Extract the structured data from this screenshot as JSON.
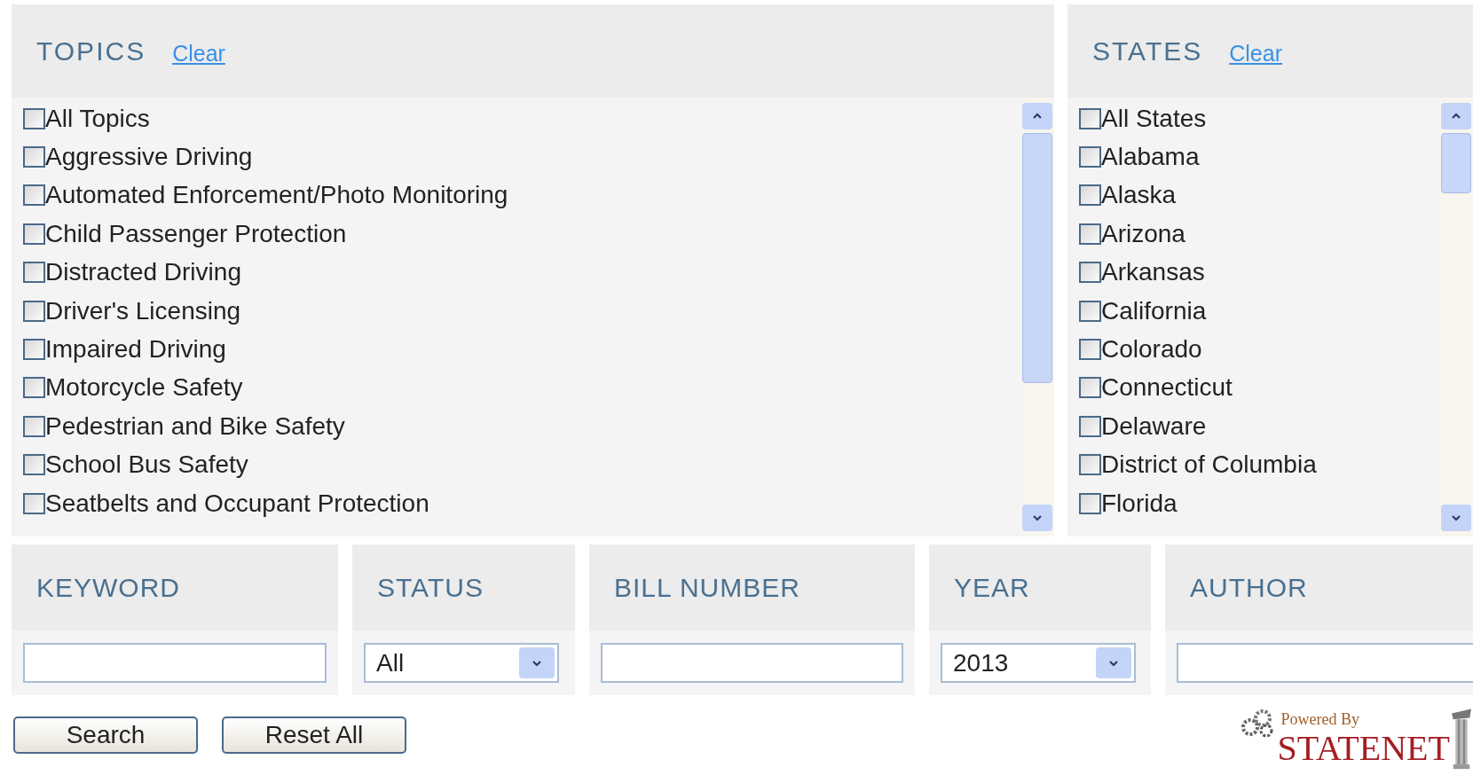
{
  "topics": {
    "title": "TOPICS",
    "clear": "Clear",
    "items": [
      {
        "label": "All Topics",
        "checked": false
      },
      {
        "label": "Aggressive Driving",
        "checked": false
      },
      {
        "label": "Automated Enforcement/Photo Monitoring",
        "checked": false
      },
      {
        "label": "Child Passenger Protection",
        "checked": false
      },
      {
        "label": "Distracted Driving",
        "checked": false
      },
      {
        "label": "Driver's Licensing",
        "checked": false
      },
      {
        "label": "Impaired Driving",
        "checked": false
      },
      {
        "label": "Motorcycle Safety",
        "checked": false
      },
      {
        "label": "Pedestrian and Bike Safety",
        "checked": false
      },
      {
        "label": "School Bus Safety",
        "checked": false
      },
      {
        "label": "Seatbelts and Occupant Protection",
        "checked": false
      }
    ]
  },
  "states": {
    "title": "STATES",
    "clear": "Clear",
    "items": [
      {
        "label": "All States",
        "checked": false
      },
      {
        "label": "Alabama",
        "checked": false
      },
      {
        "label": "Alaska",
        "checked": false
      },
      {
        "label": "Arizona",
        "checked": false
      },
      {
        "label": "Arkansas",
        "checked": false
      },
      {
        "label": "California",
        "checked": false
      },
      {
        "label": "Colorado",
        "checked": false
      },
      {
        "label": "Connecticut",
        "checked": false
      },
      {
        "label": "Delaware",
        "checked": false
      },
      {
        "label": "District of Columbia",
        "checked": false
      },
      {
        "label": "Florida",
        "checked": false
      }
    ]
  },
  "filters": [
    {
      "kind": "text",
      "label": "KEYWORD"
    },
    {
      "kind": "select",
      "label": "STATUS",
      "value": "All"
    },
    {
      "kind": "text",
      "label": "BILL NUMBER"
    },
    {
      "kind": "select",
      "label": "YEAR",
      "value": "2013"
    },
    {
      "kind": "text",
      "label": "AUTHOR"
    }
  ],
  "buttons": [
    "Search",
    "Reset All"
  ],
  "logo": {
    "tagline": "Powered By",
    "name": "STATENET"
  }
}
